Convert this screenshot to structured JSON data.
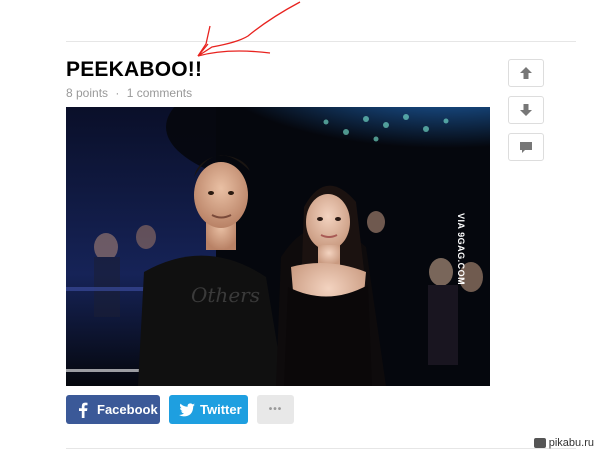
{
  "post": {
    "title": "PEEKABOO!!",
    "points": "8 points",
    "separator": "·",
    "comments": "1 comments",
    "image_watermark": "VIA 9GAG.COM",
    "image_alt": "photo"
  },
  "actions": {
    "upvote_icon": "arrow-up-icon",
    "downvote_icon": "arrow-down-icon",
    "comment_icon": "comment-icon"
  },
  "share": {
    "facebook_label": "Facebook",
    "twitter_label": "Twitter",
    "more_label": "•••"
  },
  "footer": {
    "site_logo": "pikabu.ru"
  },
  "colors": {
    "facebook": "#3b5998",
    "twitter": "#1e9fe0",
    "annotation": "#e8231f"
  }
}
